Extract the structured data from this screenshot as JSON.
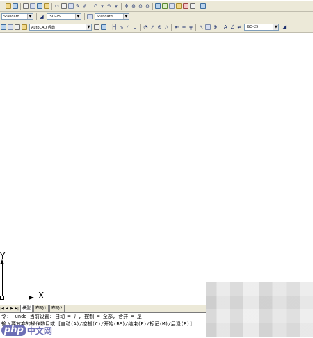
{
  "toolbar_row2": {
    "text_style": "Standard",
    "dim_style": "ISO-25",
    "table_style": "Standard"
  },
  "toolbar_row3": {
    "workspace": "AutoCAD 经典",
    "dim_style": "ISO-25"
  },
  "ucs": {
    "x_label": "X",
    "y_label": "Y"
  },
  "layout_tabs": {
    "model": "模型",
    "layout1": "布局1",
    "layout2": "布局2"
  },
  "command_lines": [
    "令: _undo 当前设置: 自动 = 开, 控制 = 全部, 合并 = 是",
    "输入要放弃的操作数目或 [自动(A)/控制(C)/开始(BE)/结束(E)/标记(M)/后退(B)]"
  ],
  "watermark": {
    "brand": "php",
    "suffix": "中文网"
  }
}
